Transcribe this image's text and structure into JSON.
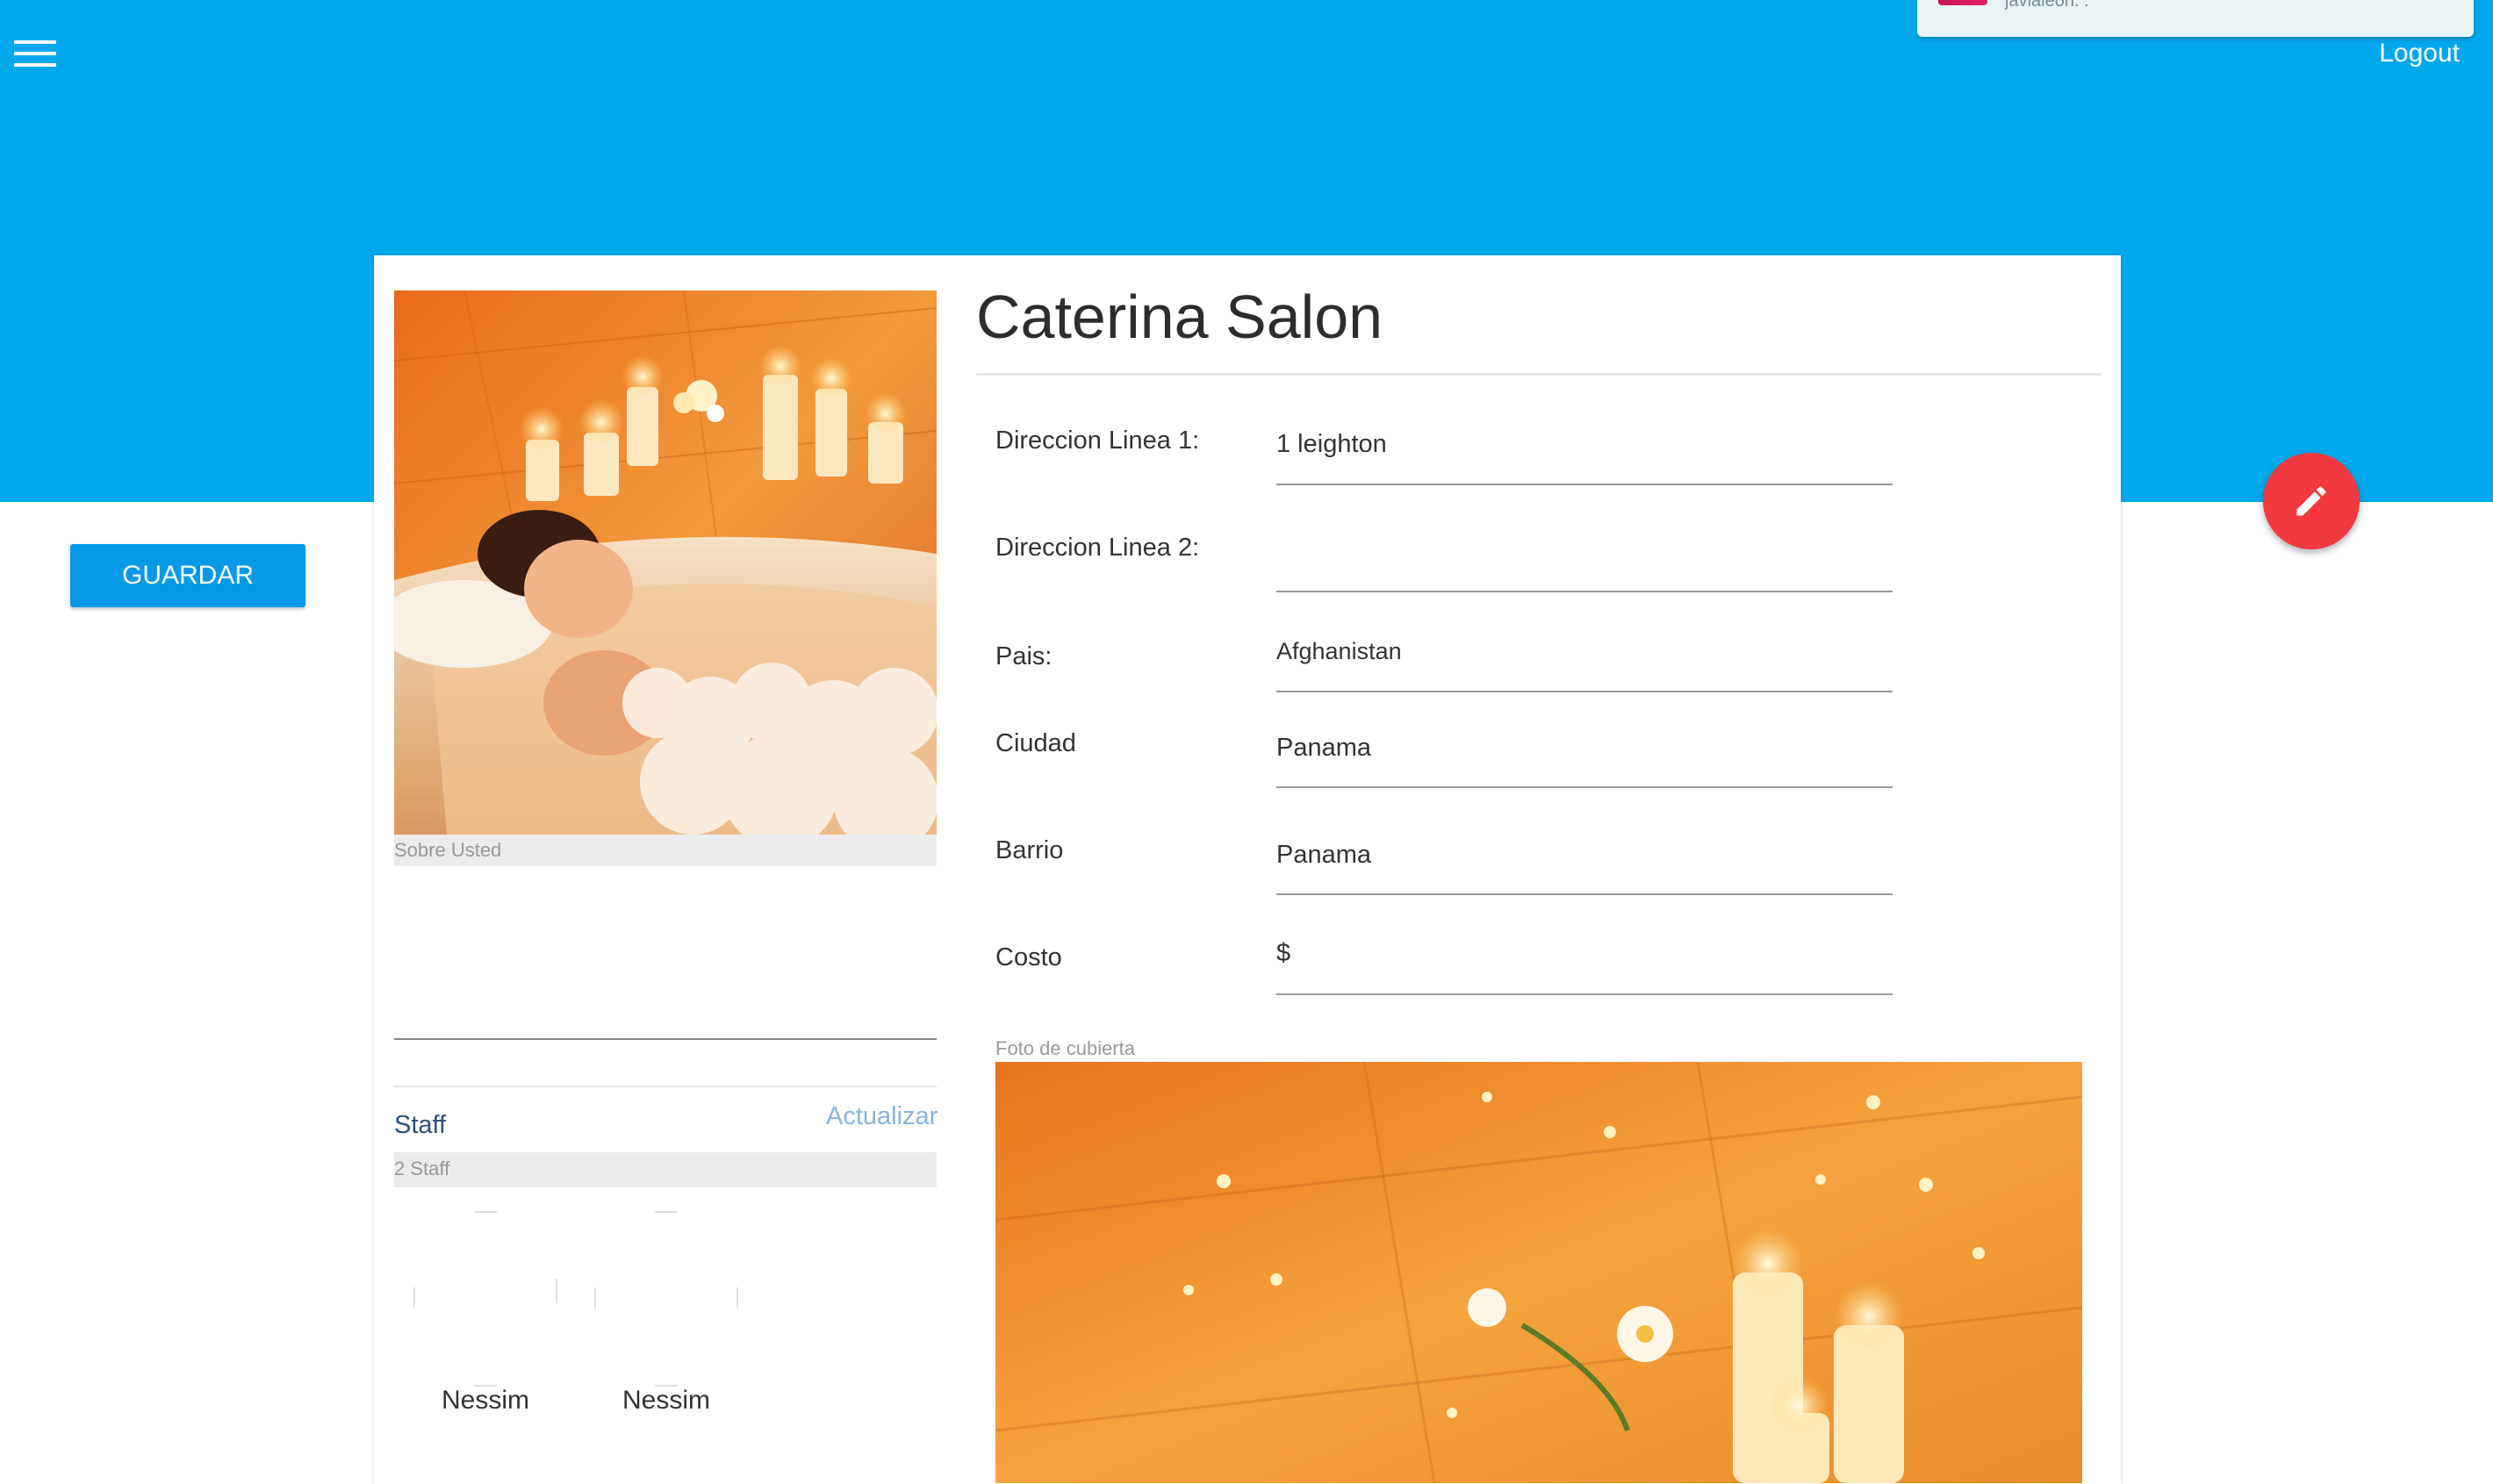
{
  "header": {
    "notification_text": "javialeon. :",
    "logout_label": "Logout"
  },
  "actions": {
    "guardar_label": "GUARDAR"
  },
  "profile": {
    "name": "Caterina Salon",
    "sobre_label": "Sobre Usted",
    "sobre_value": ""
  },
  "fields": [
    {
      "label": "Direccion Linea 1:",
      "value": "1 leighton"
    },
    {
      "label": "Direccion Linea 2:",
      "value": ""
    },
    {
      "label": "Pais:",
      "value": "Afghanistan"
    },
    {
      "label": "Ciudad",
      "value": "Panama"
    },
    {
      "label": "Barrio",
      "value": "Panama"
    },
    {
      "label": "Costo",
      "value": "$"
    }
  ],
  "cover": {
    "label": "Foto de cubierta"
  },
  "staff": {
    "title": "Staff",
    "update_label": "Actualizar",
    "count_label": "2 Staff",
    "members": [
      {
        "name": "Nessim"
      },
      {
        "name": "Nessim"
      }
    ]
  },
  "colors": {
    "header_bg": "#02a8ec",
    "primary_button": "#0599e8",
    "fab": "#f2393f",
    "staff_title": "#2f4e7c",
    "link": "#88b4d8"
  },
  "icons": {
    "menu": "hamburger-menu-icon",
    "edit": "pencil-icon"
  }
}
